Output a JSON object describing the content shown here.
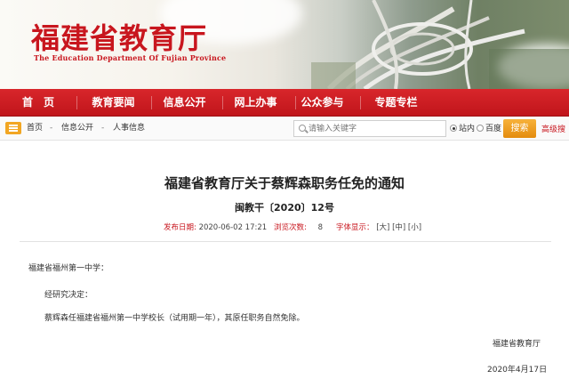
{
  "banner": {
    "title": "福建省教育厅",
    "subtitle": "The Education Department Of Fujian Province"
  },
  "nav": {
    "items": [
      "首　页",
      "教育要闻",
      "信息公开",
      "网上办事",
      "公众参与",
      "专题专栏"
    ]
  },
  "breadcrumb": {
    "items": [
      "首页",
      "信息公开",
      "人事信息"
    ],
    "separator": "-"
  },
  "search": {
    "placeholder": "请输入关键字",
    "scope_options": [
      "站内",
      "百度"
    ],
    "selected_scope": "站内",
    "button_label": "搜索",
    "advanced_label": "高级搜"
  },
  "article": {
    "title": "福建省教育厅关于蔡辉森职务任免的通知",
    "doc_number": "闽教干〔2020〕12号",
    "meta": {
      "publish_label": "发布日期:",
      "publish_value": "2020-06-02 17:21",
      "views_label": "浏览次数:",
      "views_value": "8",
      "fontsize_label": "字体显示：",
      "fontsize_options": [
        "[大]",
        "[中]",
        "[小]"
      ]
    },
    "recipient": "福建省福州第一中学：",
    "paragraphs": [
      "经研究决定：",
      "蔡辉森任福建省福州第一中学校长（试用期一年），其原任职务自然免除。"
    ],
    "signature": "福建省教育厅",
    "date": "2020年4月17日"
  },
  "colors": {
    "brand_red": "#c8161e",
    "search_orange": "#ec9a1b",
    "crumb_icon": "#f2a623"
  }
}
